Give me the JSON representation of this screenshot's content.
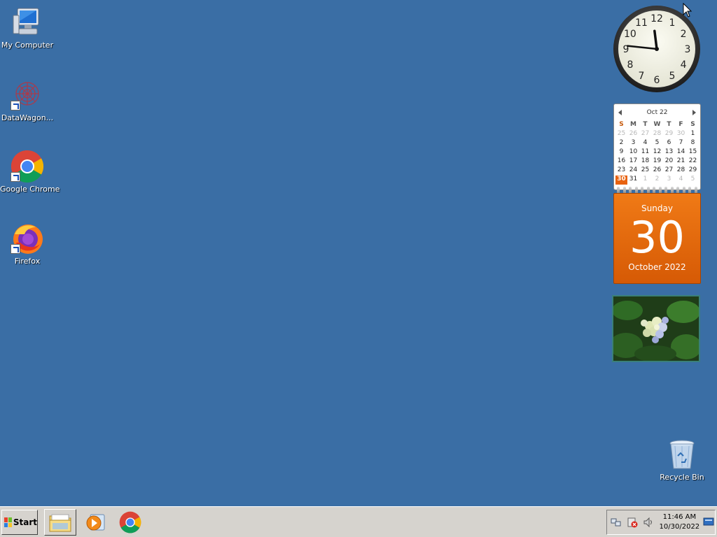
{
  "desktop": {
    "icons": [
      {
        "label": "My Computer",
        "icon": "computer-icon"
      },
      {
        "label": "DataWagon...",
        "icon": "datawagon-icon"
      },
      {
        "label": "Google Chrome",
        "icon": "chrome-icon"
      },
      {
        "label": "Firefox",
        "icon": "firefox-icon"
      },
      {
        "label": "Recycle Bin",
        "icon": "recycle-bin-icon"
      }
    ],
    "background_color": "#3a6ea5"
  },
  "clock_gadget": {
    "numerals": [
      "12",
      "1",
      "2",
      "3",
      "4",
      "5",
      "6",
      "7",
      "8",
      "9",
      "10",
      "11"
    ],
    "hour": 11,
    "minute": 46
  },
  "calendar_gadget": {
    "month_label": "Oct 22",
    "day_headers": [
      "S",
      "M",
      "T",
      "W",
      "T",
      "F",
      "S"
    ],
    "weeks": [
      [
        "25",
        "26",
        "27",
        "28",
        "29",
        "30",
        "1"
      ],
      [
        "2",
        "3",
        "4",
        "5",
        "6",
        "7",
        "8"
      ],
      [
        "9",
        "10",
        "11",
        "12",
        "13",
        "14",
        "15"
      ],
      [
        "16",
        "17",
        "18",
        "19",
        "20",
        "21",
        "22"
      ],
      [
        "23",
        "24",
        "25",
        "26",
        "27",
        "28",
        "29"
      ],
      [
        "30",
        "31",
        "1",
        "2",
        "3",
        "4",
        "5"
      ]
    ],
    "other_month_cells": [
      [
        0,
        0
      ],
      [
        0,
        1
      ],
      [
        0,
        2
      ],
      [
        0,
        3
      ],
      [
        0,
        4
      ],
      [
        0,
        5
      ],
      [
        5,
        2
      ],
      [
        5,
        3
      ],
      [
        5,
        4
      ],
      [
        5,
        5
      ],
      [
        5,
        6
      ]
    ],
    "today_cell": [
      5,
      0
    ],
    "day_of_week": "Sunday",
    "day_number": "30",
    "month_year": "October 2022",
    "accent_color": "#e8620f"
  },
  "slideshow_gadget": {
    "icon": "hydrangea-photo"
  },
  "taskbar": {
    "start_label": "Start",
    "pinned": [
      {
        "icon": "explorer-folder-icon"
      },
      {
        "icon": "media-player-icon"
      },
      {
        "icon": "chrome-icon"
      }
    ],
    "tray_icons": [
      "network-icon",
      "security-alert-icon",
      "volume-icon"
    ],
    "time": "11:46 AM",
    "date": "10/30/2022",
    "show_desktop_icon": "show-desktop-icon"
  }
}
